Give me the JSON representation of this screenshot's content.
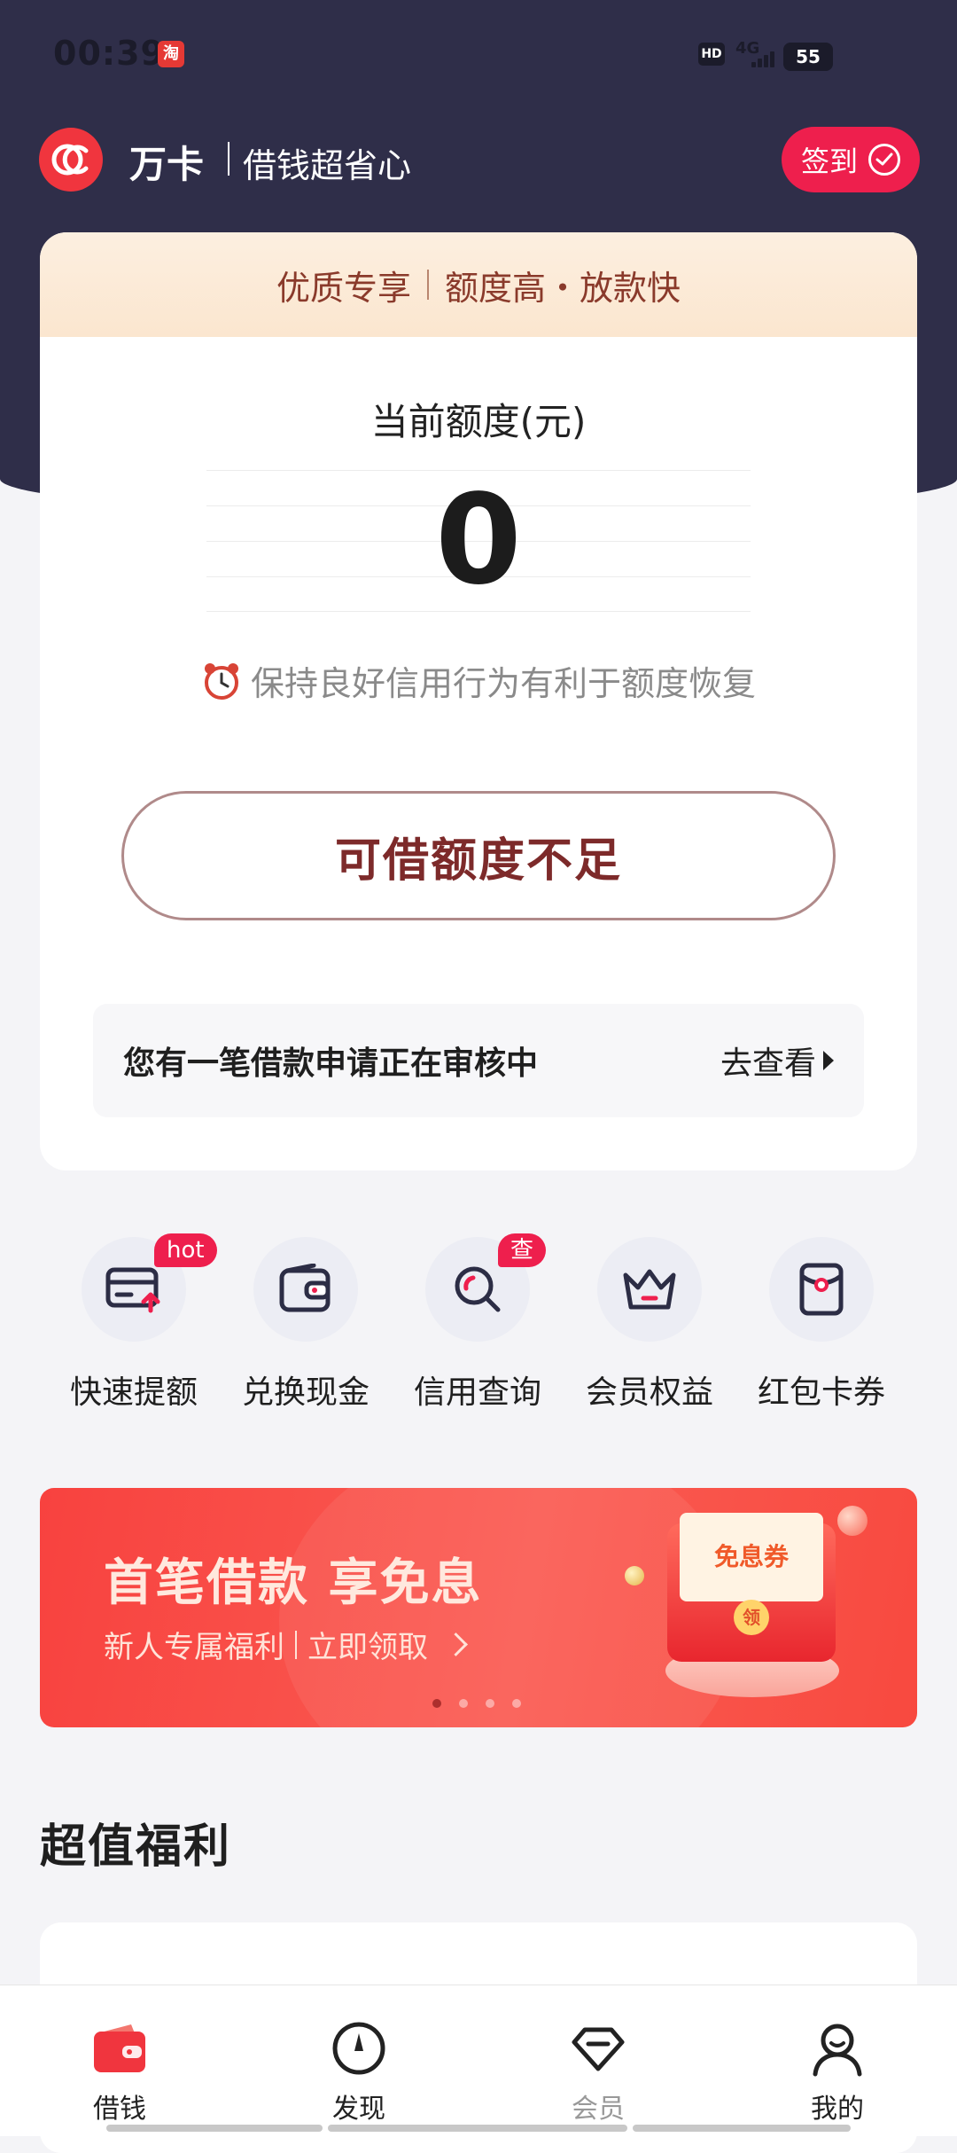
{
  "status_bar": {
    "time": "00:39",
    "app_icon_text": "淘",
    "hd": "HD",
    "network": "4G",
    "battery": "55"
  },
  "app_bar": {
    "brand": "万卡",
    "slogan": "借钱超省心",
    "signin_label": "签到"
  },
  "main_card": {
    "banner_left": "优质专享",
    "banner_right": "额度高・放款快",
    "credit_label": "当前额度(元)",
    "credit_value": "0",
    "tip": "保持良好信用行为有利于额度恢复",
    "quota_button": "可借额度不足",
    "review_text": "您有一笔借款申请正在审核中",
    "review_link": "去查看"
  },
  "entries": [
    {
      "label": "快速提额",
      "badge": "hot",
      "icon": "card-upload-icon"
    },
    {
      "label": "兑换现金",
      "badge": "",
      "icon": "wallet-icon"
    },
    {
      "label": "信用查询",
      "badge": "查",
      "icon": "search-icon"
    },
    {
      "label": "会员权益",
      "badge": "",
      "icon": "crown-icon"
    },
    {
      "label": "红包卡券",
      "badge": "",
      "icon": "red-envelope-icon"
    }
  ],
  "promo": {
    "title": "首笔借款 享免息",
    "sub_left": "新人专属福利",
    "sub_right": "立即领取",
    "coupon_text": "免息券",
    "coupon_coin": "领",
    "slides": 4,
    "active_slide": 1
  },
  "section_title": "超值福利",
  "bottom_nav": [
    {
      "label": "借钱",
      "icon": "wallet-tab-icon",
      "active": true
    },
    {
      "label": "发现",
      "icon": "compass-icon",
      "active": false
    },
    {
      "label": "会员",
      "icon": "diamond-icon",
      "active": false
    },
    {
      "label": "我的",
      "icon": "user-icon",
      "active": false
    }
  ],
  "colors": {
    "header_bg": "#2f2e49",
    "accent_red": "#ee1f4d",
    "page_bg": "#f4f4f7"
  }
}
